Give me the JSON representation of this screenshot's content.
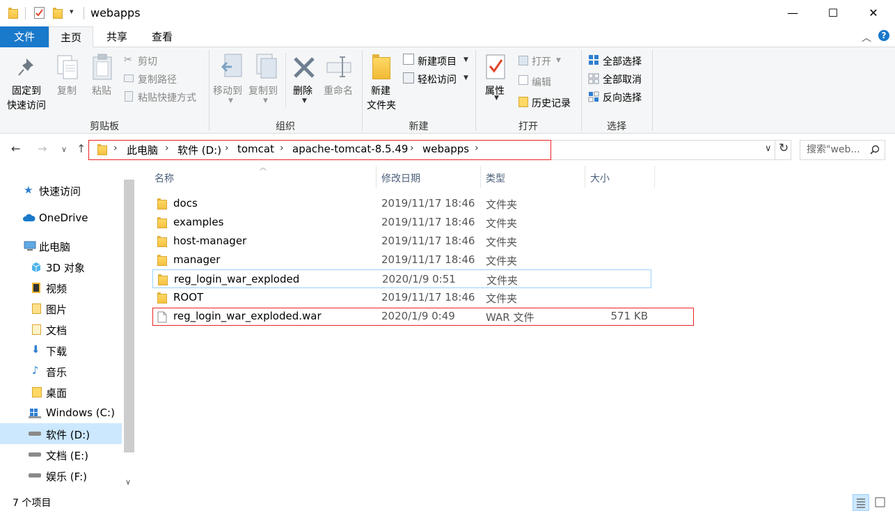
{
  "window": {
    "title": "webapps",
    "minimize": "—",
    "maximize": "☐",
    "close": "✕"
  },
  "tabs": {
    "file": "文件",
    "home": "主页",
    "share": "共享",
    "view": "查看"
  },
  "ribbon": {
    "pin_line1": "固定到",
    "pin_line2": "快速访问",
    "copy": "复制",
    "paste": "粘贴",
    "cut": "剪切",
    "copy_path": "复制路径",
    "paste_shortcut": "粘贴快捷方式",
    "clipboard_group": "剪贴板",
    "move_to": "移动到",
    "copy_to": "复制到",
    "delete": "删除",
    "rename": "重命名",
    "organize_group": "组织",
    "new_folder_line1": "新建",
    "new_folder_line2": "文件夹",
    "new_item": "新建项目",
    "easy_access": "轻松访问",
    "new_group": "新建",
    "properties": "属性",
    "open": "打开",
    "edit": "编辑",
    "history": "历史记录",
    "open_group": "打开",
    "select_all": "全部选择",
    "select_none": "全部取消",
    "invert_selection": "反向选择",
    "select_group": "选择"
  },
  "address": {
    "crumbs": [
      "此电脑",
      "软件 (D:)",
      "tomcat",
      "apache-tomcat-8.5.49",
      "webapps"
    ],
    "search_placeholder": "搜索\"web..."
  },
  "nav": {
    "quick_access": "快速访问",
    "onedrive": "OneDrive",
    "this_pc": "此电脑",
    "objects3d": "3D 对象",
    "videos": "视频",
    "pictures": "图片",
    "documents": "文档",
    "downloads": "下载",
    "music": "音乐",
    "desktop": "桌面",
    "drive_c": "Windows (C:)",
    "drive_d": "软件 (D:)",
    "drive_e": "文档 (E:)",
    "drive_f": "娱乐 (F:)"
  },
  "columns": {
    "name": "名称",
    "date": "修改日期",
    "type": "类型",
    "size": "大小"
  },
  "files": [
    {
      "name": "docs",
      "date": "2019/11/17 18:46",
      "type": "文件夹",
      "size": ""
    },
    {
      "name": "examples",
      "date": "2019/11/17 18:46",
      "type": "文件夹",
      "size": ""
    },
    {
      "name": "host-manager",
      "date": "2019/11/17 18:46",
      "type": "文件夹",
      "size": ""
    },
    {
      "name": "manager",
      "date": "2019/11/17 18:46",
      "type": "文件夹",
      "size": ""
    },
    {
      "name": "reg_login_war_exploded",
      "date": "2020/1/9 0:51",
      "type": "文件夹",
      "size": ""
    },
    {
      "name": "ROOT",
      "date": "2019/11/17 18:46",
      "type": "文件夹",
      "size": ""
    },
    {
      "name": "reg_login_war_exploded.war",
      "date": "2020/1/9 0:49",
      "type": "WAR 文件",
      "size": "571 KB"
    }
  ],
  "status": {
    "item_count": "7 个项目"
  },
  "colors": {
    "accent": "#1979ca",
    "highlight_border": "#e22222",
    "hover_border": "#99d1ff",
    "selected_bg": "#cce8ff"
  }
}
